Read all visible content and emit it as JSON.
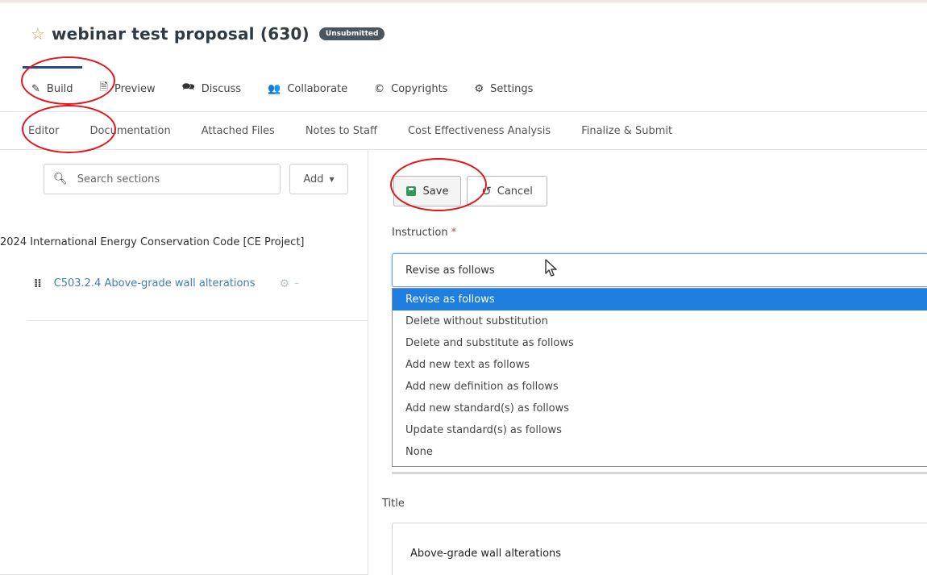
{
  "proposal": {
    "title": "webinar test proposal (630)",
    "status": "Unsubmitted"
  },
  "main_tabs": [
    {
      "label": "Build",
      "icon": "pencil-icon",
      "active": true
    },
    {
      "label": "Preview",
      "icon": "file-icon"
    },
    {
      "label": "Discuss",
      "icon": "comments-icon"
    },
    {
      "label": "Collaborate",
      "icon": "users-icon"
    },
    {
      "label": "Copyrights",
      "icon": "copyright-icon"
    },
    {
      "label": "Settings",
      "icon": "gear-icon"
    }
  ],
  "sub_tabs": [
    {
      "label": "Editor",
      "active": true
    },
    {
      "label": "Documentation"
    },
    {
      "label": "Attached Files"
    },
    {
      "label": "Notes to Staff"
    },
    {
      "label": "Cost Effectiveness Analysis"
    },
    {
      "label": "Finalize & Submit"
    }
  ],
  "sidebar": {
    "search_placeholder": "Search sections",
    "add_label": "Add",
    "tree_root": "2024 International Energy Conservation Code [CE Project]",
    "tree_item": "C503.2.4 Above-grade wall alterations"
  },
  "editor": {
    "save_label": "Save",
    "cancel_label": "Cancel",
    "instruction_label": "Instruction",
    "required_mark": "*",
    "instruction_value": "Revise as follows",
    "instruction_options": [
      "Revise as follows",
      "Delete without substitution",
      "Delete and substitute as follows",
      "Add new text as follows",
      "Add new definition as follows",
      "Add new standard(s) as follows",
      "Update standard(s) as follows",
      "None"
    ],
    "title_label": "Title",
    "title_value": "Above-grade wall alterations"
  },
  "colors": {
    "accent": "#2b4a7d",
    "link": "#3d7fb5",
    "selected_option": "#1e7fe0",
    "annotation": "#e2171b",
    "save_icon": "#2e9a58"
  }
}
